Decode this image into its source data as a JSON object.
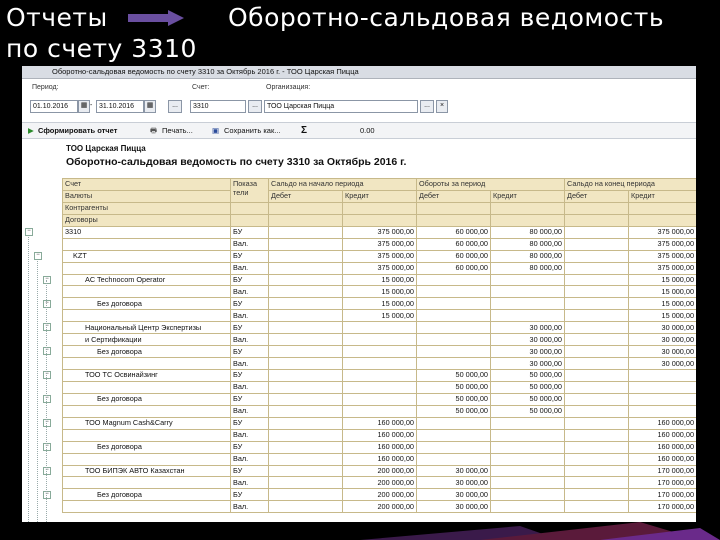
{
  "slide": {
    "title_left": "Отчеты",
    "title_right": "Оборотно-сальдовая ведомость",
    "title_line2": "по счету 3310",
    "arrow_color": "#6a4fa0"
  },
  "window": {
    "title": "Оборотно-сальдовая ведомость по счету 3310 за Октябрь 2016 г. - ТОО Царская Пицца"
  },
  "filters": {
    "period_label": "Период:",
    "period_from": "01.10.2016",
    "period_to": "31.10.2016",
    "account_label": "Счет:",
    "account_value": "3310",
    "org_label": "Организация:",
    "org_value": "ТОО Царская Пицца",
    "ellipsis": "...",
    "clear": "×"
  },
  "toolbar": {
    "generate": "Сформировать отчет",
    "print": "Печать...",
    "save": "Сохранить как...",
    "sum_symbol": "Σ",
    "sum_value": "0.00"
  },
  "report": {
    "company": "ТОО Царская Пицца",
    "title": "Оборотно-сальдовая ведомость по счету 3310 за Октябрь 2016 г.",
    "header": {
      "account": "Счет",
      "indicators": "Показа тели",
      "opening": "Сальдо на начало периода",
      "turnover": "Обороты за период",
      "closing": "Сальдо на конец периода",
      "debit": "Дебет",
      "credit": "Кредит",
      "currencies": "Валюты",
      "counterparties": "Контрагенты",
      "contract": "Договоры"
    },
    "rows": [
      {
        "name": "3310",
        "ind": "БУ",
        "od": "",
        "oc": "375 000,00",
        "td": "60 000,00",
        "tc": "80 000,00",
        "cd": "",
        "cc": "375 000,00"
      },
      {
        "name": "",
        "ind": "Вал.",
        "od": "",
        "oc": "375 000,00",
        "td": "60 000,00",
        "tc": "80 000,00",
        "cd": "",
        "cc": "375 000,00"
      },
      {
        "name": "KZT",
        "ind": "БУ",
        "od": "",
        "oc": "375 000,00",
        "td": "60 000,00",
        "tc": "80 000,00",
        "cd": "",
        "cc": "375 000,00"
      },
      {
        "name": "",
        "ind": "Вал.",
        "od": "",
        "oc": "375 000,00",
        "td": "60 000,00",
        "tc": "80 000,00",
        "cd": "",
        "cc": "375 000,00"
      },
      {
        "name": "AC Technocom Operator",
        "ind": "БУ",
        "od": "",
        "oc": "15 000,00",
        "td": "",
        "tc": "",
        "cd": "",
        "cc": "15 000,00"
      },
      {
        "name": "",
        "ind": "Вал.",
        "od": "",
        "oc": "15 000,00",
        "td": "",
        "tc": "",
        "cd": "",
        "cc": "15 000,00"
      },
      {
        "name": "Без договора",
        "ind": "БУ",
        "od": "",
        "oc": "15 000,00",
        "td": "",
        "tc": "",
        "cd": "",
        "cc": "15 000,00"
      },
      {
        "name": "",
        "ind": "Вал.",
        "od": "",
        "oc": "15 000,00",
        "td": "",
        "tc": "",
        "cd": "",
        "cc": "15 000,00"
      },
      {
        "name": "Национальный Центр Экспертизы",
        "ind": "БУ",
        "od": "",
        "oc": "",
        "td": "",
        "tc": "30 000,00",
        "cd": "",
        "cc": "30 000,00"
      },
      {
        "name": "и Сертификации",
        "ind": "Вал.",
        "od": "",
        "oc": "",
        "td": "",
        "tc": "30 000,00",
        "cd": "",
        "cc": "30 000,00"
      },
      {
        "name": "Без договора",
        "ind": "БУ",
        "od": "",
        "oc": "",
        "td": "",
        "tc": "30 000,00",
        "cd": "",
        "cc": "30 000,00"
      },
      {
        "name": "",
        "ind": "Вал.",
        "od": "",
        "oc": "",
        "td": "",
        "tc": "30 000,00",
        "cd": "",
        "cc": "30 000,00"
      },
      {
        "name": "ТОО ТС Освинайзинг",
        "ind": "БУ",
        "od": "",
        "oc": "",
        "td": "50 000,00",
        "tc": "50 000,00",
        "cd": "",
        "cc": ""
      },
      {
        "name": "",
        "ind": "Вал.",
        "od": "",
        "oc": "",
        "td": "50 000,00",
        "tc": "50 000,00",
        "cd": "",
        "cc": ""
      },
      {
        "name": "Без договора",
        "ind": "БУ",
        "od": "",
        "oc": "",
        "td": "50 000,00",
        "tc": "50 000,00",
        "cd": "",
        "cc": ""
      },
      {
        "name": "",
        "ind": "Вал.",
        "od": "",
        "oc": "",
        "td": "50 000,00",
        "tc": "50 000,00",
        "cd": "",
        "cc": ""
      },
      {
        "name": "ТОО Magnum Cash&Carry",
        "ind": "БУ",
        "od": "",
        "oc": "160 000,00",
        "td": "",
        "tc": "",
        "cd": "",
        "cc": "160 000,00"
      },
      {
        "name": "",
        "ind": "Вал.",
        "od": "",
        "oc": "160 000,00",
        "td": "",
        "tc": "",
        "cd": "",
        "cc": "160 000,00"
      },
      {
        "name": "Без договора",
        "ind": "БУ",
        "od": "",
        "oc": "160 000,00",
        "td": "",
        "tc": "",
        "cd": "",
        "cc": "160 000,00"
      },
      {
        "name": "",
        "ind": "Вал.",
        "od": "",
        "oc": "160 000,00",
        "td": "",
        "tc": "",
        "cd": "",
        "cc": "160 000,00"
      },
      {
        "name": "ТОО БИПЭК АВТО Казахстан",
        "ind": "БУ",
        "od": "",
        "oc": "200 000,00",
        "td": "30 000,00",
        "tc": "",
        "cd": "",
        "cc": "170 000,00"
      },
      {
        "name": "",
        "ind": "Вал.",
        "od": "",
        "oc": "200 000,00",
        "td": "30 000,00",
        "tc": "",
        "cd": "",
        "cc": "170 000,00"
      },
      {
        "name": "Без договора",
        "ind": "БУ",
        "od": "",
        "oc": "200 000,00",
        "td": "30 000,00",
        "tc": "",
        "cd": "",
        "cc": "170 000,00"
      },
      {
        "name": "",
        "ind": "Вал.",
        "od": "",
        "oc": "200 000,00",
        "td": "30 000,00",
        "tc": "",
        "cd": "",
        "cc": "170 000,00"
      }
    ]
  }
}
